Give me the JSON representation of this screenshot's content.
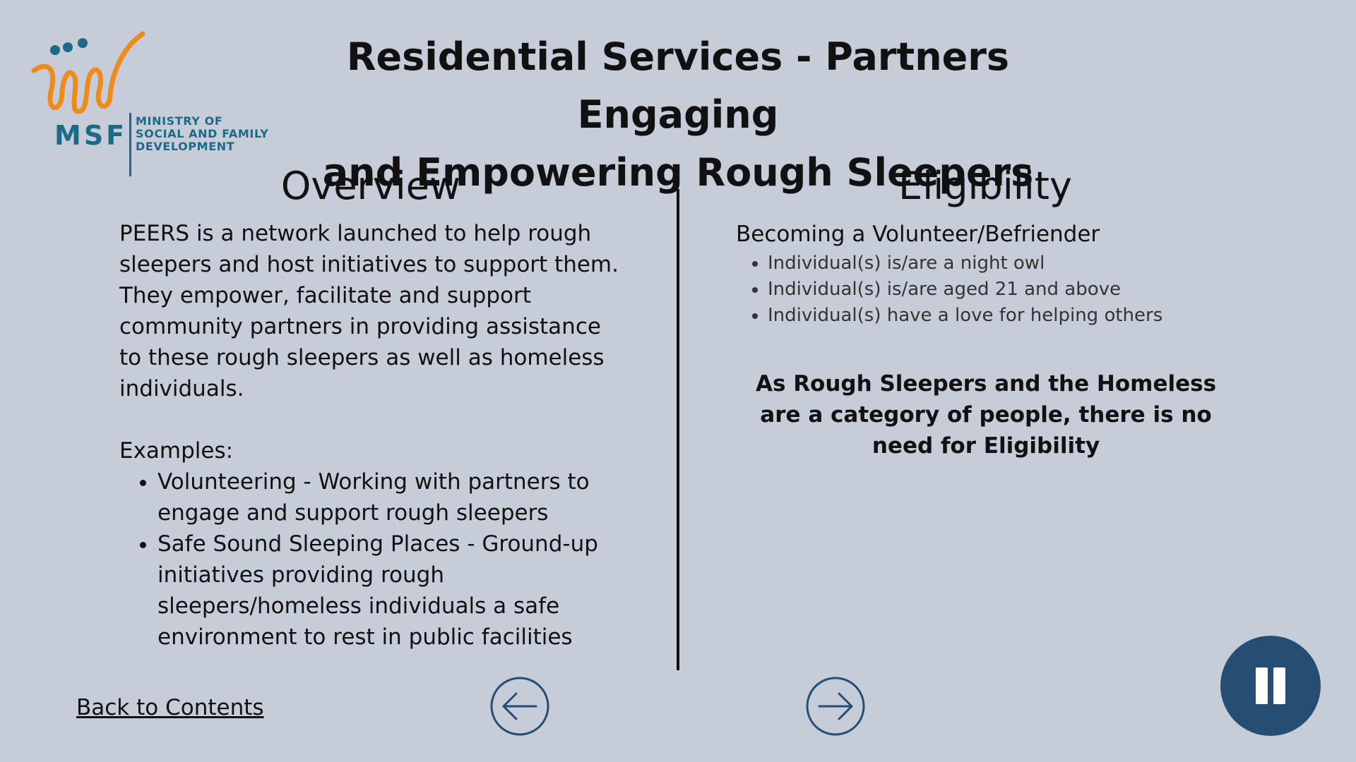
{
  "logo": {
    "abbr": "MSF",
    "line1": "MINISTRY OF",
    "line2": "SOCIAL AND FAMILY",
    "line3": "DEVELOPMENT"
  },
  "title": {
    "line1": "Residential Services - Partners Engaging",
    "line2": "and Empowering Rough Sleepers"
  },
  "overview": {
    "heading": "Overview",
    "description": "PEERS is a network launched to help rough sleepers and host initiatives to support them. They empower, facilitate and support community partners in providing assistance to these rough sleepers as well as homeless individuals.",
    "examples_label": "Examples:",
    "examples": [
      "Volunteering - Working with partners to engage and support rough sleepers",
      "Safe Sound Sleeping Places - Ground-up initiatives providing rough sleepers/homeless individuals a safe environment to rest in public facilities"
    ]
  },
  "eligibility": {
    "heading": "Eligibility",
    "subheading": "Becoming a Volunteer/Befriender",
    "criteria": [
      "Individual(s) is/are a night owl",
      "Individual(s) is/are aged 21 and above",
      "Individual(s) have a love for helping others"
    ],
    "note": "As Rough Sleepers and the Homeless are a category of people, there is no need for Eligibility"
  },
  "nav": {
    "back_label": "Back to Contents",
    "prev_icon": "arrow-left-circle-icon",
    "next_icon": "arrow-right-circle-icon",
    "pause_icon": "pause-icon"
  },
  "colors": {
    "background": "#c6ccd8",
    "accent": "#264d73",
    "logo_orange": "#f08a1c",
    "logo_teal": "#1d6a86"
  }
}
